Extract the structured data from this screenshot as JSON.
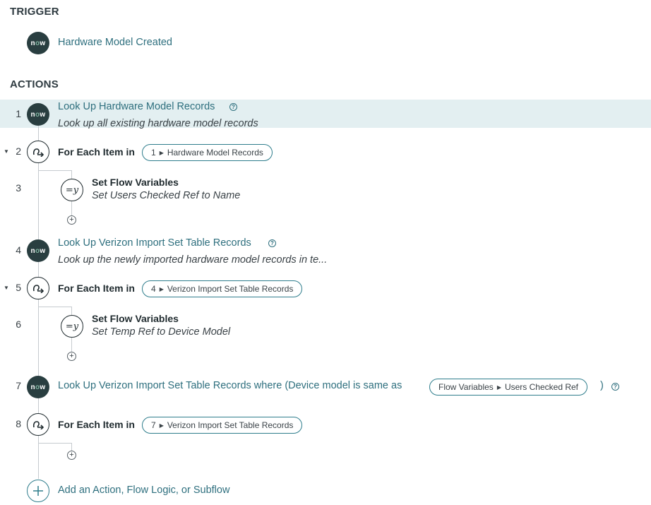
{
  "sections": {
    "trigger": "TRIGGER",
    "actions": "ACTIONS"
  },
  "trigger": {
    "icon": "now-logo-icon",
    "logo_text": "now",
    "label": "Hardware Model Created"
  },
  "steps": [
    {
      "number": "1",
      "title": "Look Up Hardware Model Records",
      "description": "Look up all existing hardware model records"
    },
    {
      "number": "2",
      "label": "For Each Item in",
      "pill_index": "1",
      "pill_text": "Hardware Model Records"
    },
    {
      "number": "3",
      "title": "Set Flow Variables",
      "description": "Set Users Checked Ref to Name"
    },
    {
      "number": "4",
      "title": "Look Up Verizon Import Set Table Records",
      "description": "Look up the newly imported hardware model records in te..."
    },
    {
      "number": "5",
      "label": "For Each Item in",
      "pill_index": "4",
      "pill_text": "Verizon Import Set Table Records"
    },
    {
      "number": "6",
      "title": "Set Flow Variables",
      "description": "Set Temp Ref to Device Model"
    },
    {
      "number": "7",
      "title": "Look Up Verizon Import Set Table Records where (Device model is same as",
      "pill_index": "Flow Variables",
      "pill_text": "Users Checked Ref",
      "close": ")"
    },
    {
      "number": "8",
      "label": "For Each Item in",
      "pill_index": "7",
      "pill_text": "Verizon Import Set Table Records"
    }
  ],
  "add": {
    "label": "Add an Action, Flow Logic, or Subflow",
    "mini_plus": "+"
  },
  "glyphs": {
    "caret": "▼",
    "tri": "▶",
    "help": "?",
    "var": "=y"
  },
  "colors": {
    "accent": "#2e6f7e",
    "highlight": "#e3eff1",
    "now_bg": "#293e40"
  }
}
